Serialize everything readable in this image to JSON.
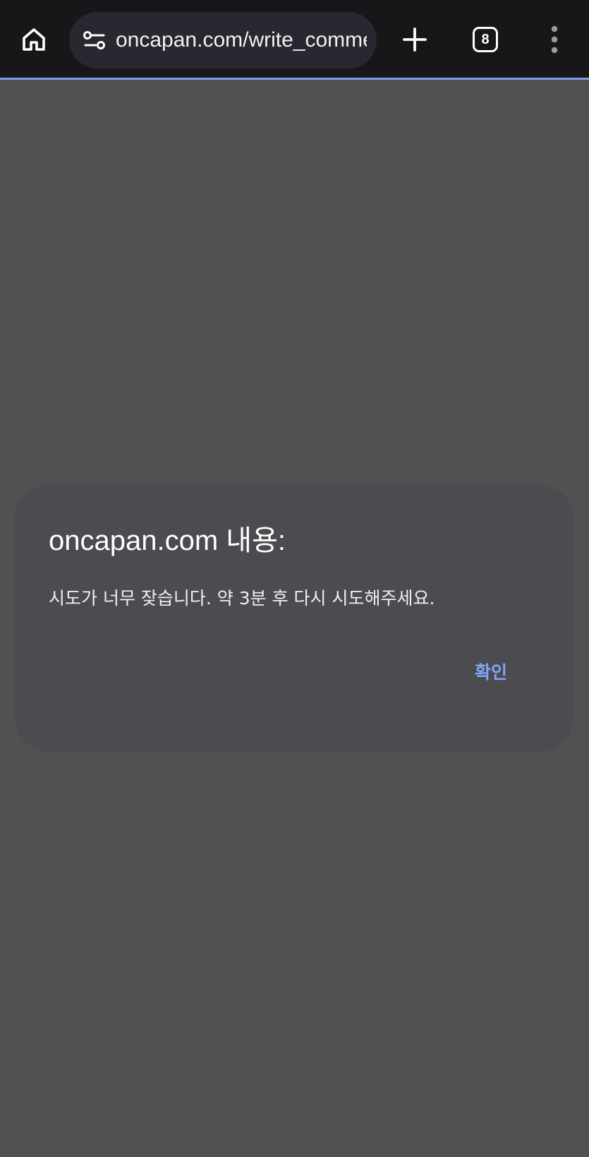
{
  "browser": {
    "url": "oncapan.com/write_comment_update.php",
    "tab_count": "8",
    "icons": {
      "home": "home-icon",
      "site_info": "tune-icon",
      "new_tab": "plus-icon",
      "tabs": "tab-switcher-icon",
      "menu": "more-vert-icon"
    },
    "colors": {
      "toolbar_bg": "#17171a",
      "omnibox_bg": "#272830",
      "progress_line": "#7a9fe8"
    }
  },
  "dialog": {
    "title": "oncapan.com 내용:",
    "message": "시도가 너무 잦습니다. 약 3분 후 다시 시도해주세요.",
    "confirm_label": "확인",
    "colors": {
      "background": "#4c4b50",
      "accent": "#7ea6f5",
      "scrim": "#515151"
    }
  }
}
